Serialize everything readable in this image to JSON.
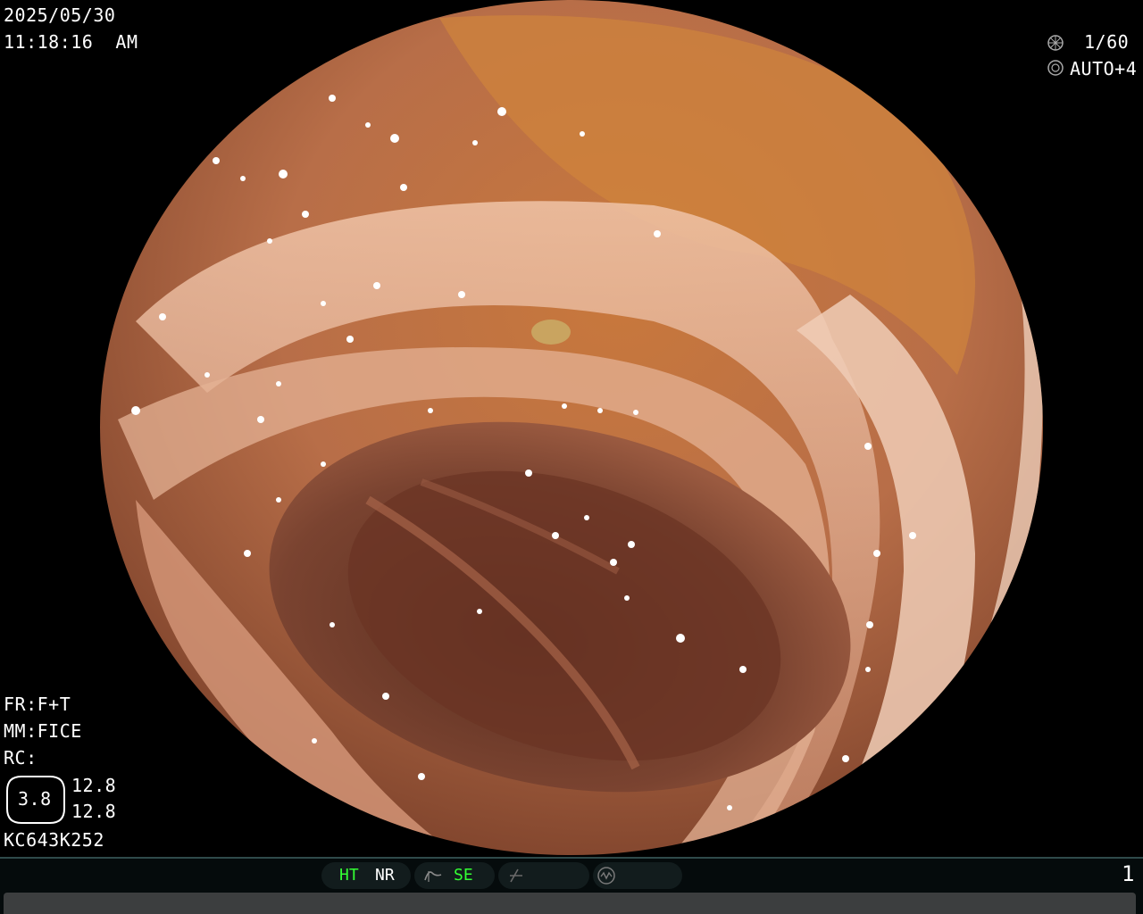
{
  "overlay": {
    "date": "2025/05/30",
    "time": "11:18:16  AM",
    "shutter": "1/60",
    "iris": "AUTO+4",
    "fr": "FR:F+T",
    "mm": "MM:FICE",
    "rc": "RC:",
    "zoom_circle": "3.8",
    "value_top": "12.8",
    "value_bottom": "12.8",
    "scope_id": "KC643K252"
  },
  "status_bar": {
    "ht": "HT",
    "nr": "NR",
    "se": "SE",
    "page": "1",
    "active_color": "#33ff33"
  },
  "icons": [
    "shutter-icon",
    "iris-icon",
    "curve-icon",
    "slash-icon",
    "wave-icon",
    "freeze-icon"
  ]
}
